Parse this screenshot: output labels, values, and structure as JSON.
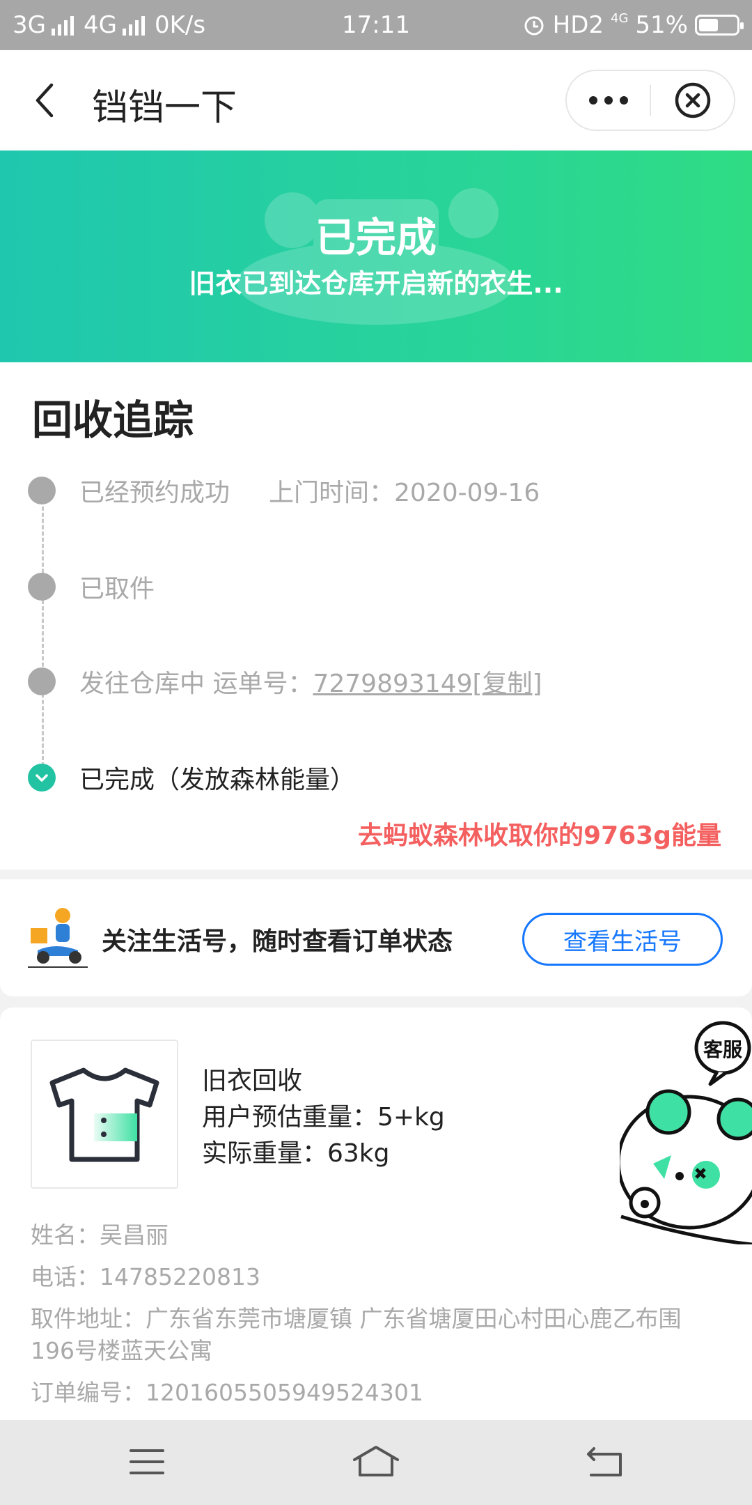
{
  "status_bar": {
    "net1": "3G",
    "net2": "4G",
    "speed": "0K/s",
    "time": "17:11",
    "hd": "HD2",
    "net3": "4G",
    "battery": "51%",
    "battery_level": 0.51
  },
  "header": {
    "title": "铛铛一下"
  },
  "banner": {
    "title": "已完成",
    "subtitle": "旧衣已到达仓库开启新的衣生..."
  },
  "tracking": {
    "title": "回收追踪",
    "steps": [
      {
        "text": "已经预约成功",
        "extra": "上门时间：2020-09-16"
      },
      {
        "text": "已取件"
      },
      {
        "text": "发往仓库中 运单号：",
        "link": "7279893149[复制]"
      },
      {
        "text": "已完成（发放森林能量）"
      }
    ],
    "energy_text": "去蚂蚁森林收取你的9763g能量"
  },
  "follow": {
    "text": "关注生活号，随时查看订单状态",
    "button": "查看生活号"
  },
  "order": {
    "product": "旧衣回收",
    "est_weight": "用户预估重量：5+kg",
    "actual_weight": "实际重量：63kg",
    "name": "姓名：吴昌丽",
    "phone": "电话：14785220813",
    "address": "取件地址：广东省东莞市塘厦镇 广东省塘厦田心村田心鹿乙布围196号楼蓝天公寓",
    "order_no": "订单编号：1201605505949524301",
    "service_label": "客服"
  },
  "colors": {
    "banner_start": "#1fc7ae",
    "banner_end": "#2fdc84",
    "accent_teal": "#21c3a3",
    "energy_red": "#f45f5f",
    "link_blue": "#1677ff"
  }
}
